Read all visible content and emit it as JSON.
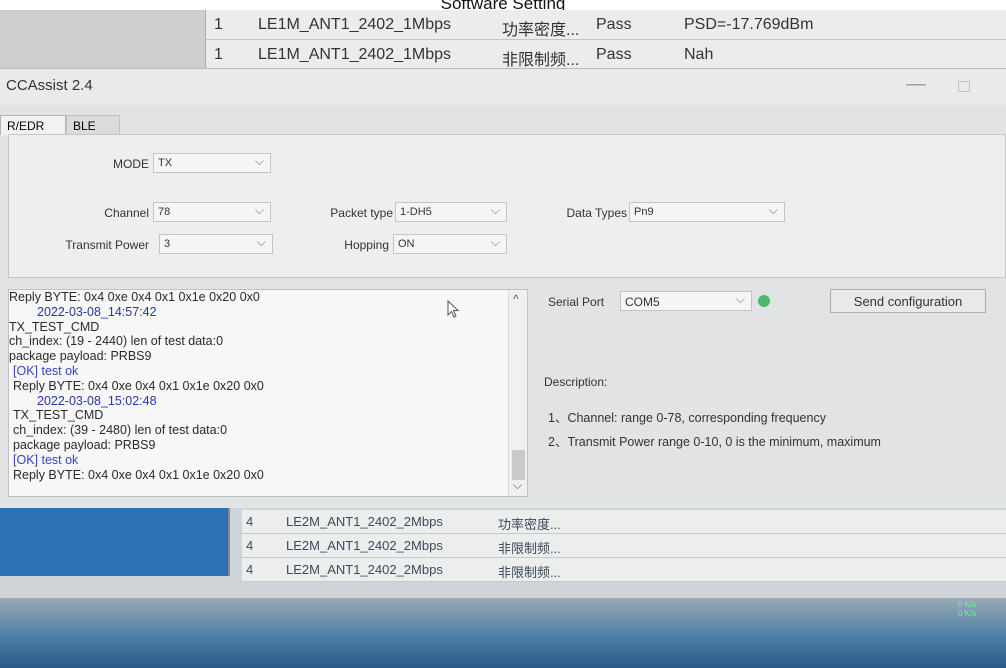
{
  "caption": "Software Setting",
  "background_table_top": [
    {
      "idx": "1",
      "name": "LE1M_ANT1_2402_1Mbps",
      "test": "功率密度...",
      "result": "Pass",
      "value": "PSD=-17.769dBm"
    },
    {
      "idx": "1",
      "name": "LE1M_ANT1_2402_1Mbps",
      "test": "非限制频...",
      "result": "Pass",
      "value": "Nah"
    }
  ],
  "window": {
    "title": "CCAssist 2.4",
    "tabs": [
      "R/EDR",
      "BLE"
    ]
  },
  "config": {
    "mode": {
      "label": "MODE",
      "value": "TX"
    },
    "channel": {
      "label": "Channel",
      "value": "78"
    },
    "packet_type": {
      "label": "Packet type",
      "value": "1-DH5"
    },
    "data_types": {
      "label": "Data Types",
      "value": "Pn9"
    },
    "transmit_power": {
      "label": "Transmit Power",
      "value": "3"
    },
    "hopping": {
      "label": "Hopping",
      "value": "ON"
    }
  },
  "log": [
    "Reply BYTE: 0x4 0xe 0x4 0x1 0x1e 0x20 0x0",
    "2022-03-08_14:57:42",
    "TX_TEST_CMD",
    "ch_index: (19 - 2440)  len of test data:0",
    "package payload: PRBS9",
    "[OK] test ok",
    "Reply BYTE: 0x4 0xe 0x4 0x1 0x1e 0x20 0x0",
    "2022-03-08_15:02:48",
    "TX_TEST_CMD",
    "ch_index: (39 - 2480)  len of test data:0",
    "package payload: PRBS9",
    "[OK] test ok",
    "Reply BYTE: 0x4 0xe 0x4 0x1 0x1e 0x20 0x0"
  ],
  "serial": {
    "label": "Serial Port",
    "value": "COM5"
  },
  "send_button": "Send configuration",
  "description": {
    "title": "Description:",
    "lines": [
      "1、Channel: range 0-78, corresponding frequency",
      "2、Transmit Power  range 0-10, 0 is the minimum, maximum"
    ]
  },
  "background_table_bottom": [
    {
      "idx": "4",
      "name": "LE2M_ANT1_2402_2Mbps",
      "test": "功率密度..."
    },
    {
      "idx": "4",
      "name": "LE2M_ANT1_2402_2Mbps",
      "test": "非限制频..."
    },
    {
      "idx": "4",
      "name": "LE2M_ANT1_2402_2Mbps",
      "test": "非限制频..."
    }
  ],
  "net_speed": {
    "up": "0 K/s",
    "down": "0 K/s"
  }
}
